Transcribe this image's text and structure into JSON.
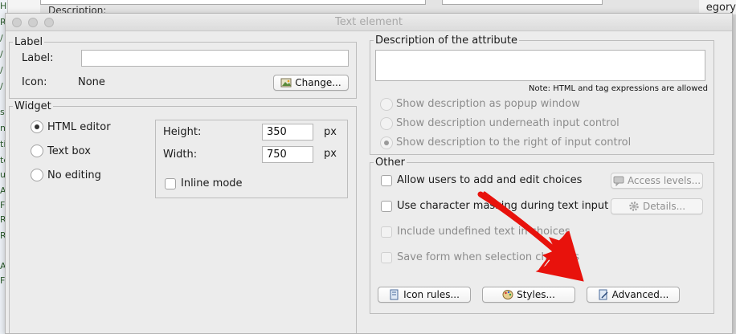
{
  "background": {
    "left_fragments": [
      "H1",
      "R",
      "/",
      "/",
      "/",
      "/",
      "ss",
      "nt",
      "tis",
      "te",
      "ur",
      "A",
      "F",
      "R",
      "R",
      "A",
      "F"
    ],
    "top_label": "Description:",
    "right_label": "egory"
  },
  "window": {
    "title": "Text element"
  },
  "label_group": {
    "legend": "Label",
    "label_caption": "Label:",
    "label_value": "",
    "icon_caption": "Icon:",
    "icon_value": "None",
    "change_button": "Change..."
  },
  "widget_group": {
    "legend": "Widget",
    "options": [
      {
        "label": "HTML editor",
        "checked": true
      },
      {
        "label": "Text box",
        "checked": false
      },
      {
        "label": "No editing",
        "checked": false
      }
    ],
    "height_caption": "Height:",
    "height_value": "350",
    "height_unit": "px",
    "width_caption": "Width:",
    "width_value": "750",
    "width_unit": "px",
    "inline_mode": "Inline mode"
  },
  "description_group": {
    "legend": "Description of the attribute",
    "value": "",
    "note": "Note: HTML and tag expressions are allowed",
    "options": [
      {
        "label": "Show description as popup window",
        "checked": false
      },
      {
        "label": "Show description underneath input control",
        "checked": false
      },
      {
        "label": "Show description to the right of input control",
        "checked": true
      }
    ]
  },
  "other_group": {
    "legend": "Other",
    "allow_choices": "Allow users to add and edit choices",
    "access_levels_button": "Access levels...",
    "char_masking": "Use character masking during text input",
    "details_button": "Details...",
    "include_undefined": "Include undefined text in choices",
    "save_form": "Save form when selection changes",
    "icon_rules_button": "Icon rules...",
    "styles_button": "Styles...",
    "advanced_button": "Advanced..."
  },
  "annotation": {
    "arrow_color": "#e8120c"
  }
}
